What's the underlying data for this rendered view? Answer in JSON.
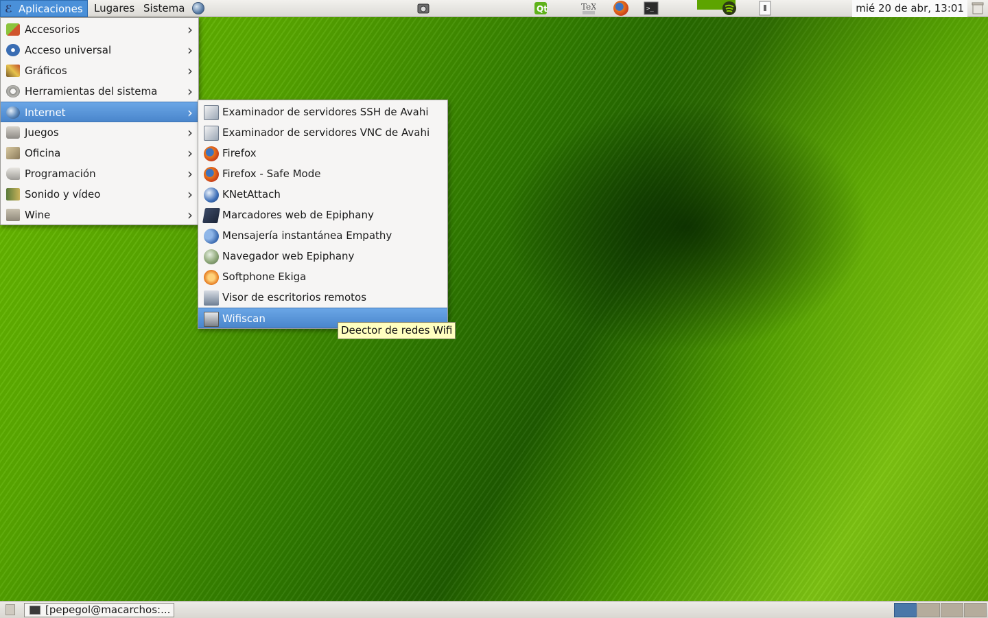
{
  "top_panel": {
    "menus": [
      {
        "label": "Aplicaciones",
        "active": true
      },
      {
        "label": "Lugares"
      },
      {
        "label": "Sistema"
      }
    ],
    "clock": "mié 20 de abr, 13:01",
    "launchers": [
      "screenshot-icon",
      "qt-designer-icon",
      "tex-icon",
      "firefox-icon",
      "terminal-icon",
      "spotify-icon",
      "usb-icon",
      "trash-icon"
    ]
  },
  "apps_menu": {
    "items": [
      {
        "label": "Accesorios",
        "icon": "accessories-icon"
      },
      {
        "label": "Acceso universal",
        "icon": "universal-access-icon"
      },
      {
        "label": "Gráficos",
        "icon": "graphics-icon"
      },
      {
        "label": "Herramientas del sistema",
        "icon": "system-tools-icon"
      },
      {
        "label": "Internet",
        "icon": "internet-icon",
        "selected": true
      },
      {
        "label": "Juegos",
        "icon": "games-icon"
      },
      {
        "label": "Oficina",
        "icon": "office-icon"
      },
      {
        "label": "Programación",
        "icon": "programming-icon"
      },
      {
        "label": "Sonido y vídeo",
        "icon": "sound-video-icon"
      },
      {
        "label": "Wine",
        "icon": "wine-folder-icon"
      }
    ]
  },
  "internet_submenu": {
    "items": [
      {
        "label": "Examinador de servidores SSH de Avahi",
        "icon": "avahi-ssh-icon"
      },
      {
        "label": "Examinador de servidores VNC de Avahi",
        "icon": "avahi-vnc-icon"
      },
      {
        "label": "Firefox",
        "icon": "firefox-icon"
      },
      {
        "label": "Firefox - Safe Mode",
        "icon": "firefox-icon"
      },
      {
        "label": "KNetAttach",
        "icon": "knetattach-icon"
      },
      {
        "label": "Marcadores web de Epiphany",
        "icon": "bookmarks-icon"
      },
      {
        "label": "Mensajería instantánea Empathy",
        "icon": "empathy-icon"
      },
      {
        "label": "Navegador web Epiphany",
        "icon": "epiphany-icon"
      },
      {
        "label": "Softphone Ekiga",
        "icon": "ekiga-icon"
      },
      {
        "label": "Visor de escritorios remotos",
        "icon": "remote-desktop-icon"
      },
      {
        "label": "Wifiscan",
        "icon": "wifiscan-icon",
        "selected": true
      }
    ]
  },
  "tooltip": "Deector de redes Wifi",
  "bottom_panel": {
    "task": "[pepegol@macarchos:..."
  },
  "colors": {
    "selection": "#4a86cc",
    "tooltip_bg": "#ffffbf",
    "wallpaper_green": "#5aaa00"
  }
}
